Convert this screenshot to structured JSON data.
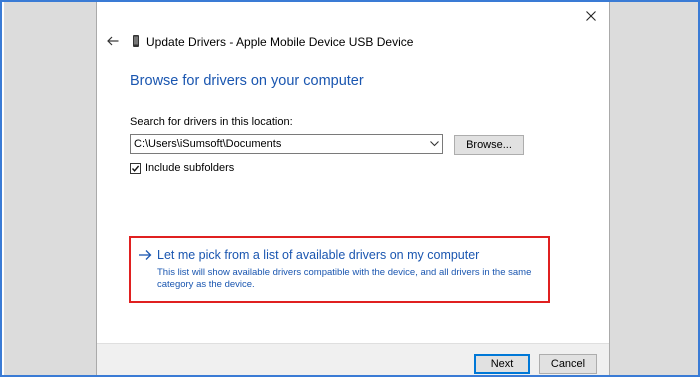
{
  "window": {
    "title": "Update Drivers - Apple Mobile Device USB Device",
    "close_icon": "close-icon",
    "back_icon": "back-arrow-icon",
    "device_icon": "usb-device-icon"
  },
  "content": {
    "heading": "Browse for drivers on your computer",
    "search_label": "Search for drivers in this location:",
    "path_value": "C:\\Users\\iSumsoft\\Documents",
    "browse_label": "Browse...",
    "include_subfolders_label": "Include subfolders",
    "include_subfolders_checked": true
  },
  "pick_option": {
    "title": "Let me pick from a list of available drivers on my computer",
    "description": "This list will show available drivers compatible with the device, and all drivers in the same category as the device.",
    "arrow_icon": "right-arrow-icon",
    "highlight_color": "#e02020"
  },
  "footer": {
    "next_label": "Next",
    "cancel_label": "Cancel"
  },
  "colors": {
    "accent": "#1a56b0",
    "frame_border": "#3a7bd5",
    "highlight": "#e02020",
    "footer_bg": "#f0f0f0"
  }
}
